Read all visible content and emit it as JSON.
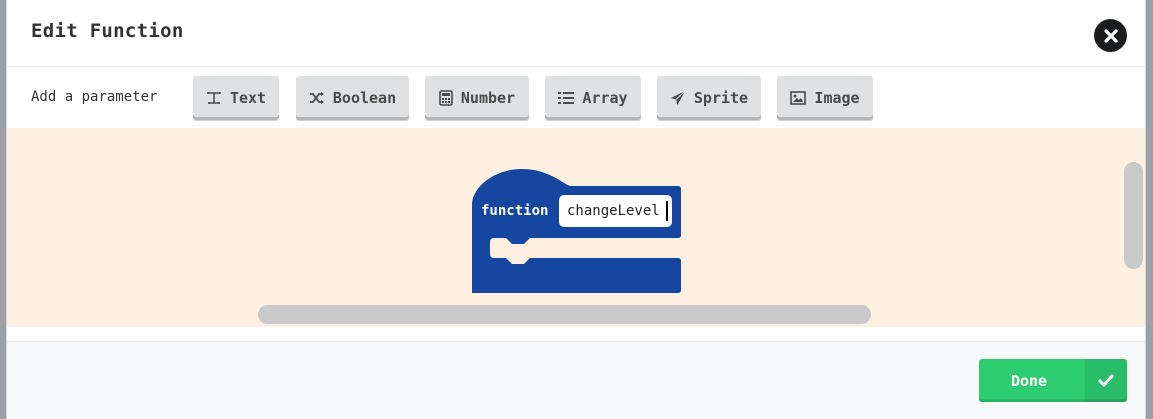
{
  "dialog": {
    "title": "Edit Function"
  },
  "parameters": {
    "label": "Add a parameter",
    "buttons": [
      {
        "label": "Text",
        "icon": "text-cursor-icon"
      },
      {
        "label": "Boolean",
        "icon": "shuffle-icon"
      },
      {
        "label": "Number",
        "icon": "calculator-icon"
      },
      {
        "label": "Array",
        "icon": "list-icon"
      },
      {
        "label": "Sprite",
        "icon": "paper-plane-icon"
      },
      {
        "label": "Image",
        "icon": "image-icon"
      }
    ]
  },
  "block": {
    "keyword": "function",
    "name_value": "changeLevel",
    "color": "#1547a0"
  },
  "workspace": {
    "background": "#fdf0e1"
  },
  "footer": {
    "done_label": "Done",
    "done_color": "#2ecc71"
  }
}
